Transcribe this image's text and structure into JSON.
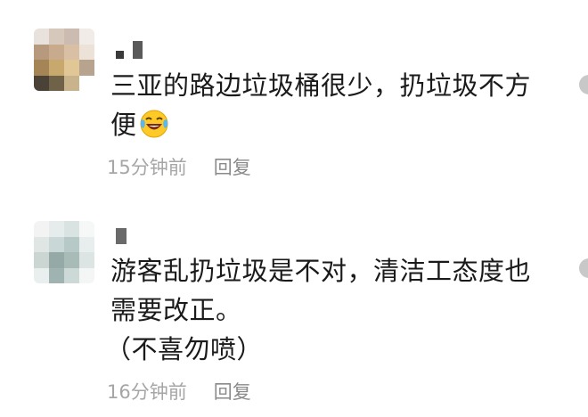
{
  "comments": [
    {
      "text_lines": [
        "三亚的路边垃圾桶很少，扔垃圾不方",
        "便"
      ],
      "emoji": "laughing-crying-emoji",
      "time": "15分钟前",
      "reply_label": "回复"
    },
    {
      "text_lines": [
        "游客乱扔垃圾是不对，清洁工态度也",
        "需要改正。",
        "（不喜勿喷）"
      ],
      "time": "16分钟前",
      "reply_label": "回复"
    }
  ],
  "colors": {
    "text": "#1a1a1a",
    "meta": "#a6a6a6",
    "background": "#ffffff"
  }
}
